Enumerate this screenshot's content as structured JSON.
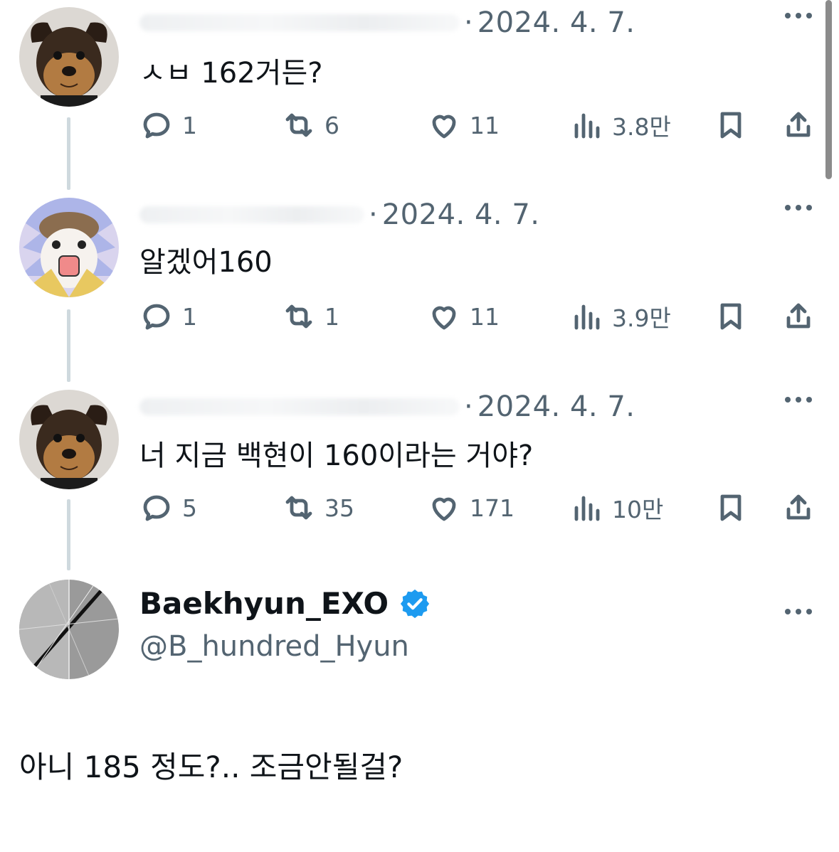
{
  "replies": [
    {
      "date": "2024. 4. 7.",
      "text": "ㅅㅂ 162거든?",
      "stats": {
        "replies": "1",
        "retweets": "6",
        "likes": "11",
        "views": "3.8만"
      }
    },
    {
      "date": "2024. 4. 7.",
      "text": "알겠어160",
      "stats": {
        "replies": "1",
        "retweets": "1",
        "likes": "11",
        "views": "3.9만"
      }
    },
    {
      "date": "2024. 4. 7.",
      "text": "너 지금 백현이 160이라는 거야?",
      "stats": {
        "replies": "5",
        "retweets": "35",
        "likes": "171",
        "views": "10만"
      }
    }
  ],
  "author": {
    "display_name": "Baekhyun_EXO",
    "handle": "@B_hundred_Hyun"
  },
  "main_tweet": {
    "text": "아니 185 정도?.. 조금안될걸?"
  },
  "colors": {
    "verified": "#1d9bf0",
    "muted": "#536471",
    "text": "#0f1419",
    "thread": "#cfd9de"
  }
}
